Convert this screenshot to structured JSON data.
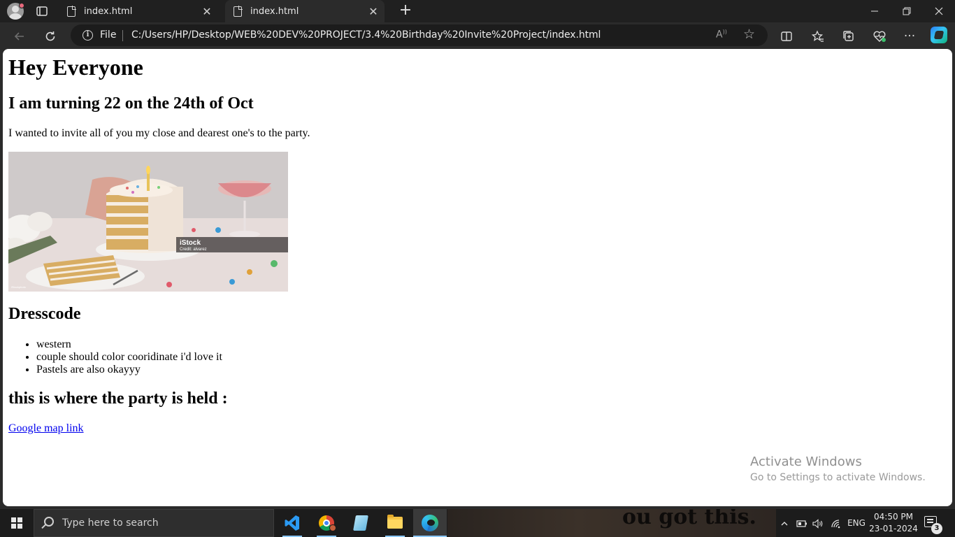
{
  "browser": {
    "tabs": [
      {
        "title": "index.html",
        "close": "✕"
      },
      {
        "title": "index.html",
        "close": "✕"
      }
    ],
    "address_bar": {
      "scheme_label": "File",
      "url": "C:/Users/HP/Desktop/WEB%20DEV%20PROJECT/3.4%20Birthday%20Invite%20Project/index.html"
    }
  },
  "page": {
    "heading": "Hey Everyone",
    "subheading": "I am turning 22 on the 24th of Oct",
    "invite_text": "I wanted to invite all of you my close and dearest one's to the party.",
    "image": {
      "watermark_brand": "iStock",
      "watermark_credit": "Credit: alvarez",
      "watermark_small": "iStockphoto"
    },
    "dresscode_heading": "Dresscode",
    "dresscode_items": [
      "western",
      "couple should color cooridinate i'd love it",
      "Pastels are also okayyy"
    ],
    "location_heading": "this is where the party is held :",
    "map_link": "Google map link"
  },
  "os_overlay": {
    "activate_title": "Activate Windows",
    "activate_subtitle": "Go to Settings to activate Windows."
  },
  "taskbar": {
    "search_placeholder": "Type here to search",
    "wallpaper_text": "ou got this.",
    "language": "ENG",
    "time": "04:50 PM",
    "date": "23-01-2024",
    "notification_count": "3",
    "running_apps": [
      "vscode-icon",
      "chrome-icon",
      "notepad-icon",
      "file-explorer-icon",
      "edge-icon"
    ]
  },
  "colors": {
    "link": "#0000ee",
    "taskbar_indicator": "#8cc8ff"
  }
}
